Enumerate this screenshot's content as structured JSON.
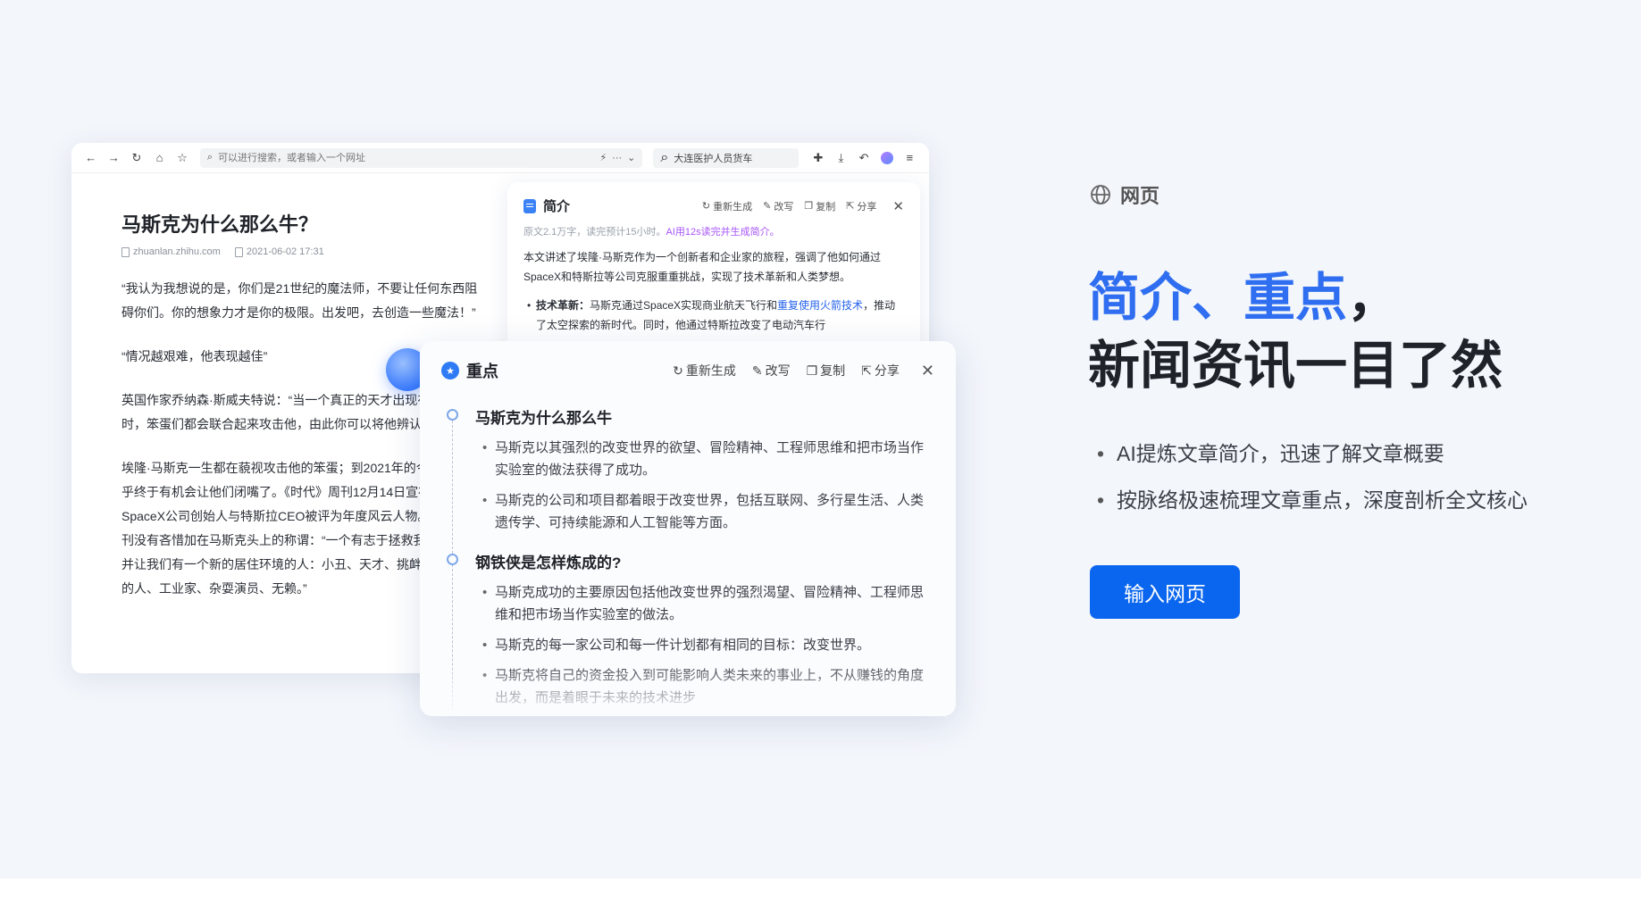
{
  "browser": {
    "address_placeholder": "可以进行搜索，或者输入一个网址",
    "search_text": "大连医护人员货车"
  },
  "article": {
    "title": "马斯克为什么那么牛？",
    "source": "zhuanlan.zhihu.com",
    "date": "2021-06-02 17:31",
    "paragraphs": [
      "“我认为我想说的是，你们是21世纪的魔法师，不要让任何东西阻碍你们。你的想象力才是你的极限。出发吧，去创造一些魔法！”",
      "“情况越艰难，他表现越佳”",
      "英国作家乔纳森·斯威夫特说：“当一个真正的天才出现在世界中时，笨蛋们都会联合起来攻击他，由此你可以将他辨认出来。”",
      "埃隆·马斯克一生都在藐视攻击他的笨蛋；到2021年的今天，他似乎终于有机会让他们闭嘴了。《时代》周刊12月14日宣布，这位SpaceX公司创始人与特斯拉CEO被评为年度风云人物。《时代》周刊没有吝惜加在马斯克头上的称谓：“一个有志于拯救我们的星球并让我们有一个新的居住环境的人：小丑、天才、挑衅者、有远见的人、工业家、杂耍演员、无赖。”"
    ]
  },
  "summary": {
    "title": "简介",
    "actions": {
      "regenerate": "重新生成",
      "rewrite": "改写",
      "copy": "复制",
      "share": "分享"
    },
    "stats": "原文2.1万字，读完预计15小时。",
    "ai_note": "AI用12s读完并生成简介。",
    "body": "本文讲述了埃隆·马斯克作为一个创新者和企业家的旅程，强调了他如何通过SpaceX和特斯拉等公司克服重重挑战，实现了技术革新和人类梦想。",
    "bullet_label": "技术革新：",
    "bullet_text": "马斯克通过SpaceX实现商业航天飞行和",
    "bullet_link": "重复使用火箭技术",
    "bullet_rest": "，推动了太空探索的新时代。同时，他通过特斯拉改变了电动汽车行"
  },
  "keypoints": {
    "title": "重点",
    "actions": {
      "regenerate": "重新生成",
      "rewrite": "改写",
      "copy": "复制",
      "share": "分享"
    },
    "sections": [
      {
        "heading": "马斯克为什么那么牛",
        "items": [
          "马斯克以其强烈的改变世界的欲望、冒险精神、工程师思维和把市场当作实验室的做法获得了成功。",
          "马斯克的公司和项目都着眼于改变世界，包括互联网、多行星生活、人类遗传学、可持续能源和人工智能等方面。"
        ]
      },
      {
        "heading": "钢铁侠是怎样炼成的?",
        "items": [
          "马斯克成功的主要原因包括他改变世界的强烈渴望、冒险精神、工程师思维和把市场当作实验室的做法。",
          "马斯克的每一家公司和每一件计划都有相同的目标：改变世界。",
          "马斯克将自己的资金投入到可能影响人类未来的事业上，不从赚钱的角度出发，而是着眼于未来的技术进步"
        ]
      }
    ]
  },
  "marketing": {
    "tag": "网页",
    "headline_hl1": "简介",
    "headline_sep": "、",
    "headline_hl2": "重点",
    "headline_comma": "，",
    "headline_line2": "新闻资讯一目了然",
    "features": [
      "AI提炼文章简介，迅速了解文章概要",
      "按脉络极速梳理文章重点，深度剖析全文核心"
    ],
    "cta_label": "输入网页"
  },
  "colors": {
    "accent": "#2f6ef0",
    "cta": "#0a66ee",
    "ai_purple": "#a855f7"
  }
}
